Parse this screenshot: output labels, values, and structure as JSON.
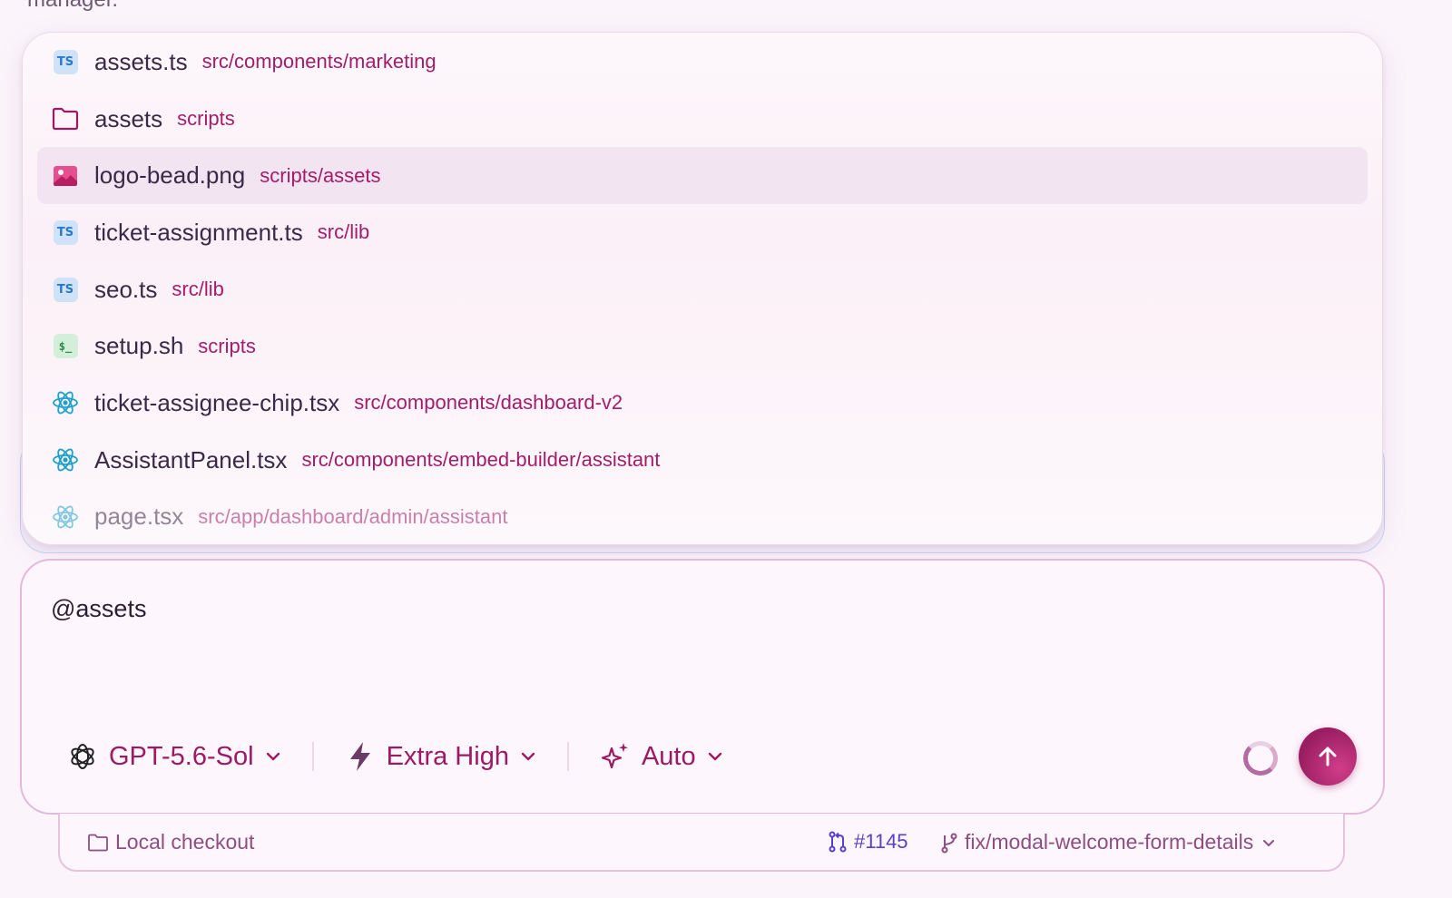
{
  "previous_message_fragment": "manager.",
  "mention_popup": {
    "items": [
      {
        "name": "assets.ts",
        "path": "src/components/marketing",
        "icon": "typescript-icon",
        "selected": false
      },
      {
        "name": "assets",
        "path": "scripts",
        "icon": "folder-icon",
        "selected": false
      },
      {
        "name": "logo-bead.png",
        "path": "scripts/assets",
        "icon": "image-icon",
        "selected": true
      },
      {
        "name": "ticket-assignment.ts",
        "path": "src/lib",
        "icon": "typescript-icon",
        "selected": false
      },
      {
        "name": "seo.ts",
        "path": "src/lib",
        "icon": "typescript-icon",
        "selected": false
      },
      {
        "name": "setup.sh",
        "path": "scripts",
        "icon": "shell-icon",
        "selected": false
      },
      {
        "name": "ticket-assignee-chip.tsx",
        "path": "src/components/dashboard-v2",
        "icon": "react-icon",
        "selected": false
      },
      {
        "name": "AssistantPanel.tsx",
        "path": "src/components/embed-builder/assistant",
        "icon": "react-icon",
        "selected": false
      },
      {
        "name": "page.tsx",
        "path": "src/app/dashboard/admin/assistant",
        "icon": "react-icon",
        "selected": false
      }
    ]
  },
  "composer": {
    "input_value": "@assets",
    "model_label": "GPT-5.6-Sol",
    "effort_label": "Extra High",
    "mode_label": "Auto"
  },
  "footer": {
    "checkout_label": "Local checkout",
    "pr_label": "#1145",
    "branch_label": "fix/modal-welcome-form-details"
  },
  "colors": {
    "accent": "#9c1a63",
    "path_text": "#a21d6a",
    "selected_row": "#f2e4f1",
    "pr_link": "#5a3fc9"
  }
}
